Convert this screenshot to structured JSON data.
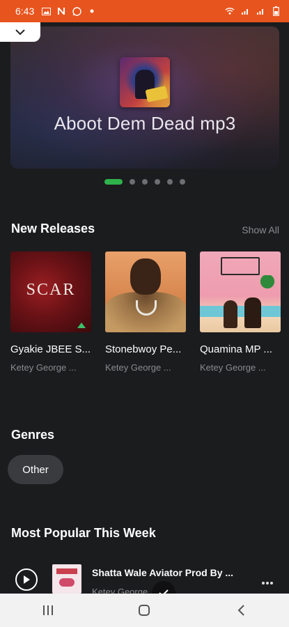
{
  "status_bar": {
    "time": "6:43",
    "background": "#e8541e",
    "left_icons": [
      "gallery-icon",
      "n-icon",
      "whatsapp-icon",
      "notification-dot-icon"
    ],
    "right_icons": [
      "wifi-icon",
      "signal-icon",
      "signal-icon",
      "battery-icon"
    ]
  },
  "hero": {
    "title": "Aboot Dem Dead mp3",
    "active_index": 0,
    "dots_count": 6
  },
  "new_releases": {
    "heading": "New Releases",
    "show_all": "Show All",
    "items": [
      {
        "title": "Gyakie JBEE S...",
        "artist": "Ketey George ...",
        "cover_text": "SCAR"
      },
      {
        "title": "Stonebwoy Pe...",
        "artist": "Ketey George ..."
      },
      {
        "title": "Quamina MP ...",
        "artist": "Ketey George ..."
      }
    ]
  },
  "genres": {
    "heading": "Genres",
    "chips": [
      "Other"
    ]
  },
  "popular": {
    "heading": "Most Popular This Week",
    "items": [
      {
        "title": "Shatta Wale Aviator Prod By ...",
        "artist": "Ketey George"
      }
    ]
  },
  "colors": {
    "accent_green": "#2fb24c",
    "background": "#1b1c1e",
    "muted_text": "#8a8b8f"
  }
}
